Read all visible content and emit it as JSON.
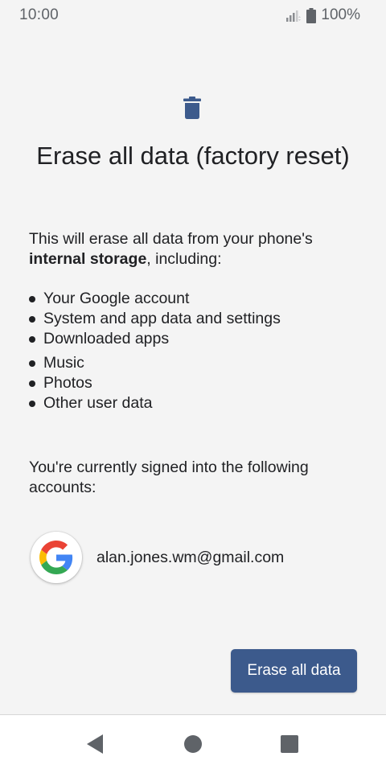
{
  "status_bar": {
    "time": "10:00",
    "battery": "100%"
  },
  "title": "Erase all data (factory reset)",
  "intro": {
    "prefix": "This will erase all data from your phone's",
    "bold": "internal storage",
    "suffix": ", including:"
  },
  "erase_items": [
    "Your Google account",
    "System and app data and settings",
    "Downloaded apps",
    "Music",
    "Photos",
    "Other user data"
  ],
  "accounts_text": "You're currently signed into the following accounts:",
  "account": {
    "email": "alan.jones.wm@gmail.com",
    "provider_icon": "google-logo"
  },
  "erase_button": {
    "label": "Erase all data"
  },
  "nav": {
    "back_icon": "back-triangle",
    "home_icon": "home-circle",
    "recents_icon": "recents-square"
  },
  "colors": {
    "background": "#f4f4f4",
    "accent": "#3c5a8c",
    "trash_icon": "#3c5a8c",
    "text": "#202124",
    "status_text": "#5f6368",
    "nav_icons": "#5f6368"
  }
}
